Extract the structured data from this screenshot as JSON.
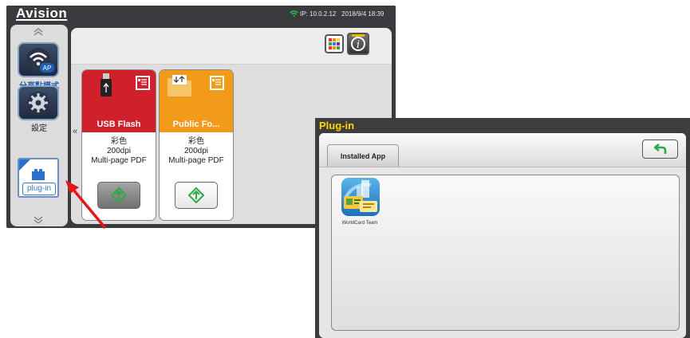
{
  "device": {
    "brand": "Avision",
    "ip": "IP: 10.0.2.12",
    "datetime": "2018/9/4 18:39",
    "sidebar": {
      "share_mode_label": "分享點模式",
      "share_mode_badge": "AP",
      "settings_label": "設定",
      "plugin_label": "plug-in"
    },
    "cards": [
      {
        "title": "USB Flash",
        "color": "Color",
        "color_label": "彩色",
        "resolution": "200dpi",
        "format": "Multi-page PDF",
        "head_color": "#d0202b"
      },
      {
        "title": "Public Fo...",
        "color_label": "彩色",
        "resolution": "200dpi",
        "format": "Multi-page PDF",
        "head_color": "#f29a1a"
      }
    ]
  },
  "plugin_window": {
    "title": "Plug-in",
    "tab_label": "Installed App",
    "apps": [
      {
        "name": "WorldCard Team",
        "icon": "worldcard-team-icon"
      }
    ]
  },
  "colors": {
    "accent_title": "#ffd700",
    "start_green": "#2fa84a"
  }
}
